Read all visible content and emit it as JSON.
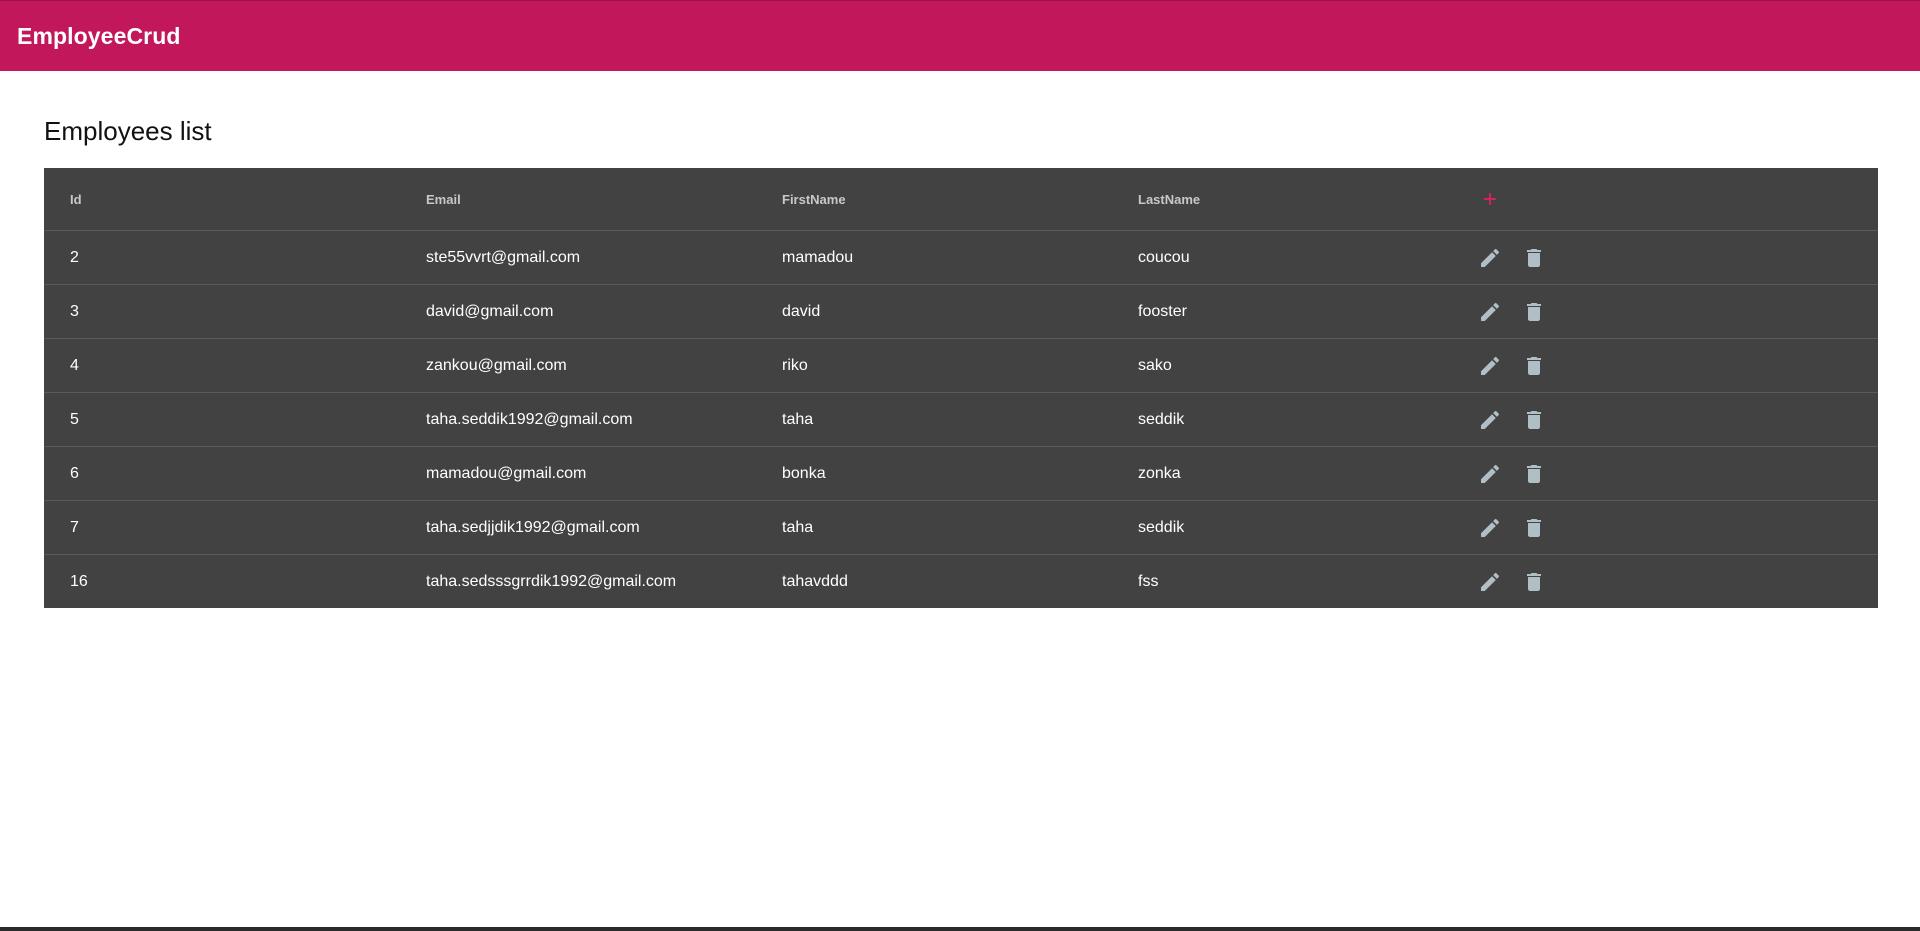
{
  "app": {
    "title": "EmployeeCrud"
  },
  "page": {
    "title": "Employees list"
  },
  "table": {
    "columns": [
      "Id",
      "Email",
      "FirstName",
      "LastName"
    ],
    "add_icon": "plus-icon",
    "row_icons": [
      "pencil-icon",
      "trash-icon"
    ],
    "rows": [
      {
        "id": "2",
        "email": "ste55vvrt@gmail.com",
        "first": "mamadou",
        "last": "coucou"
      },
      {
        "id": "3",
        "email": "david@gmail.com",
        "first": "david",
        "last": "fooster"
      },
      {
        "id": "4",
        "email": "zankou@gmail.com",
        "first": "riko",
        "last": "sako"
      },
      {
        "id": "5",
        "email": "taha.seddik1992@gmail.com",
        "first": "taha",
        "last": "seddik"
      },
      {
        "id": "6",
        "email": "mamadou@gmail.com",
        "first": "bonka",
        "last": "zonka"
      },
      {
        "id": "7",
        "email": "taha.sedjjdik1992@gmail.com",
        "first": "taha",
        "last": "seddik"
      },
      {
        "id": "16",
        "email": "taha.sedsssgrrdik1992@gmail.com",
        "first": "tahavddd",
        "last": "fss"
      }
    ]
  },
  "colors": {
    "toolbar": "#c2185b",
    "table_bg": "#424242",
    "accent": "#e91e63",
    "icon": "#b0bec5"
  }
}
